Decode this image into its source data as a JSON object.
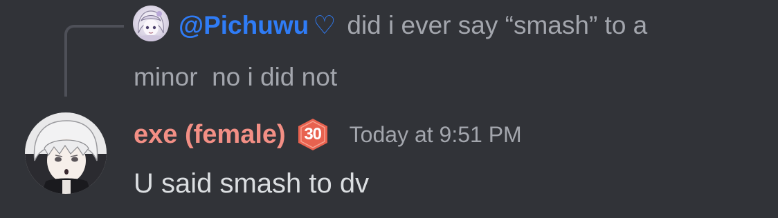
{
  "reply": {
    "author_mention": "@Pichuwu",
    "author_decoration": "♡",
    "author_color": "#2f7cf6",
    "text_line1": "did i ever say “smash” to a",
    "text_line2": "minor  no i did not",
    "avatar_icon": "anime-girl-avatar-icon"
  },
  "message": {
    "username": "exe (female)",
    "username_color": "#f38f85",
    "level_badge": "30",
    "badge_color": "#e8624f",
    "timestamp": "Today at 9:51 PM",
    "content": "U said smash to dv",
    "avatar_icon": "anime-boy-avatar-icon"
  },
  "theme": {
    "background": "#313338",
    "muted_text": "#a3a6ad",
    "body_text": "#dbdee1"
  }
}
